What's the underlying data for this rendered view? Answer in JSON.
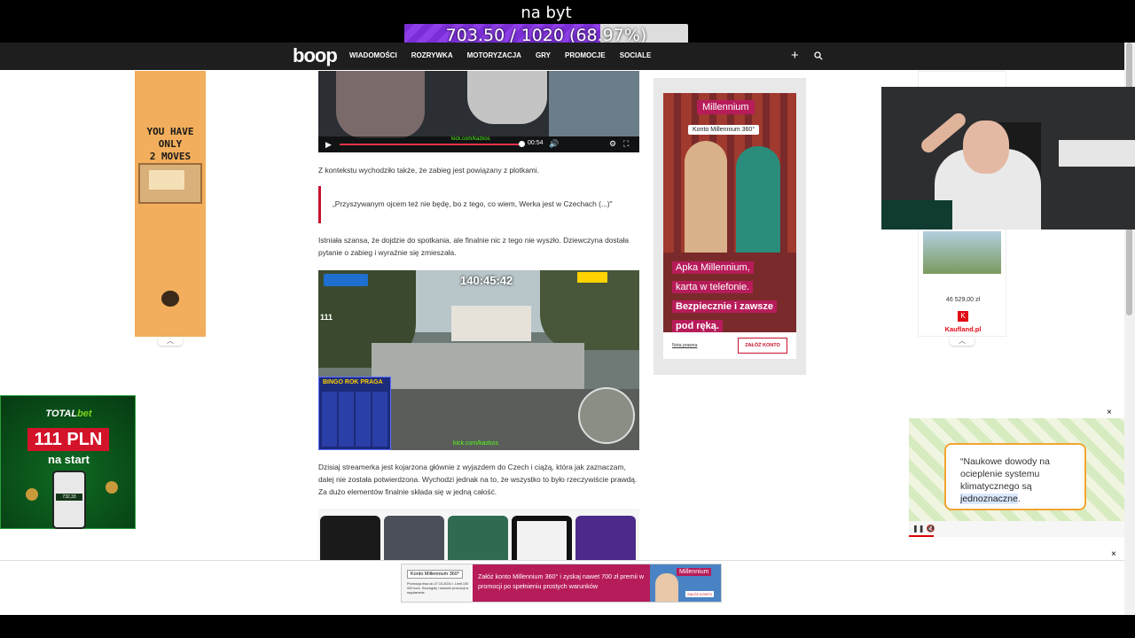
{
  "overlay": {
    "goal_title": "na byt",
    "goal_text": "703.50 / 1020 (68.97%)",
    "goal_progress": 0.6897,
    "goal_color": "#7a2fd6"
  },
  "nav": {
    "logo": "boop",
    "items": [
      "WIADOMOŚCI",
      "ROZRYWKA",
      "MOTORYZACJA",
      "GRY",
      "PROMOCJE",
      "SOCIALE"
    ],
    "plus_icon": "plus-icon",
    "search_icon": "search-icon"
  },
  "left_ad": {
    "text_line1": "YOU HAVE ONLY",
    "text_line2": "2 MOVES",
    "bg_color": "#f2ae5c"
  },
  "video_top": {
    "time": "00:54",
    "brand": "kick.com/kazkos"
  },
  "article": {
    "para1": "Z kontekstu wychodziło także, że zabieg jest powiązany z plotkami.",
    "quote": "„Przyszywanym ojcem też nie będę, bo z tego, co wiem, Werka jest w Czechach (...)\"",
    "para2": "Istniała szansa, że dojdzie do spotkania, ale finalnie nic z tego nie wyszło. Dziewczyna dostała pytanie o zabieg i wyraźnie się zmieszała.",
    "para3": "Dzisiaj streamerka jest kojarzona głównie z wyjazdem do Czech i ciążą, która jak zaznaczam, dalej nie została potwierdzona. Wychodzi jednak na to, że wszystko to było rzeczywiście prawdą. Za dużo elementów finalnie składa się w jedną całość."
  },
  "video_main": {
    "timer": "140:45:42",
    "viewers": "111",
    "card_title": "BINGO ROK PRAGA",
    "kick": "kick.com/kazkos"
  },
  "millennium_ad": {
    "brand": "Millennium",
    "chip": "Konto Millennium 360°",
    "line1": "Apka Millennium,",
    "line2": "karta w telefonie.",
    "line3": "Bezpiecznie i zawsze",
    "line4": "pod ręką.",
    "note": "Nota prawna",
    "cta": "ZAŁÓŻ KONTO",
    "accent": "#b71c5a"
  },
  "kaufland_ad": {
    "price": "46 529,00 zł",
    "name": "Kaufland.pl",
    "logo": "K",
    "color": "#e10915"
  },
  "totalbet_ad": {
    "logo_a": "TOTAL",
    "logo_b": "bet",
    "amount": "111 PLN",
    "sub": "na start",
    "phone_value": "732,33"
  },
  "climate_ad": {
    "text_before": "Naukowe dowody na ocieplenie systemu klimatycznego są",
    "text_highlight": "jednoznaczne",
    "text_after": ".",
    "close": "×"
  },
  "bottom_ad": {
    "chip": "Konto Millennium 360°",
    "small": "Promocja trwa do 27.10.2024 r. Limit 100 000 kont. Szczegóły i warunki promocji w regulaminie.",
    "text": "Załóż konto Millennium 360° i zyskaj nawet 700 zł premii w promocji po spełnieniu prostych warunków",
    "brand": "Millennium",
    "cta": "ZAŁÓŻ KONTO",
    "close": "×"
  }
}
